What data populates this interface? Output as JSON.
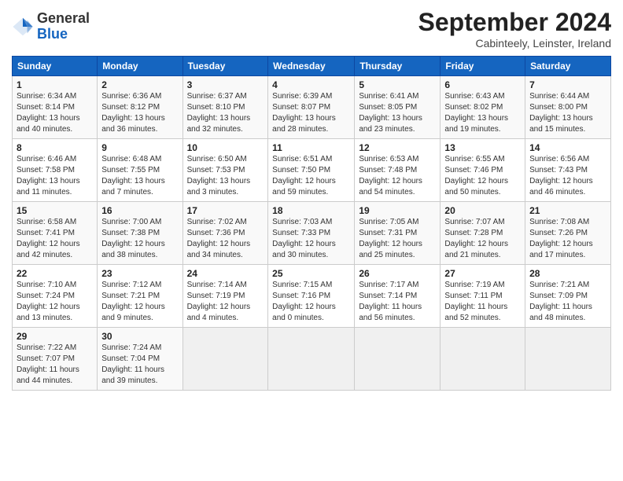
{
  "header": {
    "logo_general": "General",
    "logo_blue": "Blue",
    "title": "September 2024",
    "subtitle": "Cabinteely, Leinster, Ireland"
  },
  "columns": [
    "Sunday",
    "Monday",
    "Tuesday",
    "Wednesday",
    "Thursday",
    "Friday",
    "Saturday"
  ],
  "weeks": [
    [
      {
        "day": "1",
        "sunrise": "6:34 AM",
        "sunset": "8:14 PM",
        "daylight": "13 hours and 40 minutes."
      },
      {
        "day": "2",
        "sunrise": "6:36 AM",
        "sunset": "8:12 PM",
        "daylight": "13 hours and 36 minutes."
      },
      {
        "day": "3",
        "sunrise": "6:37 AM",
        "sunset": "8:10 PM",
        "daylight": "13 hours and 32 minutes."
      },
      {
        "day": "4",
        "sunrise": "6:39 AM",
        "sunset": "8:07 PM",
        "daylight": "13 hours and 28 minutes."
      },
      {
        "day": "5",
        "sunrise": "6:41 AM",
        "sunset": "8:05 PM",
        "daylight": "13 hours and 23 minutes."
      },
      {
        "day": "6",
        "sunrise": "6:43 AM",
        "sunset": "8:02 PM",
        "daylight": "13 hours and 19 minutes."
      },
      {
        "day": "7",
        "sunrise": "6:44 AM",
        "sunset": "8:00 PM",
        "daylight": "13 hours and 15 minutes."
      }
    ],
    [
      {
        "day": "8",
        "sunrise": "6:46 AM",
        "sunset": "7:58 PM",
        "daylight": "13 hours and 11 minutes."
      },
      {
        "day": "9",
        "sunrise": "6:48 AM",
        "sunset": "7:55 PM",
        "daylight": "13 hours and 7 minutes."
      },
      {
        "day": "10",
        "sunrise": "6:50 AM",
        "sunset": "7:53 PM",
        "daylight": "13 hours and 3 minutes."
      },
      {
        "day": "11",
        "sunrise": "6:51 AM",
        "sunset": "7:50 PM",
        "daylight": "12 hours and 59 minutes."
      },
      {
        "day": "12",
        "sunrise": "6:53 AM",
        "sunset": "7:48 PM",
        "daylight": "12 hours and 54 minutes."
      },
      {
        "day": "13",
        "sunrise": "6:55 AM",
        "sunset": "7:46 PM",
        "daylight": "12 hours and 50 minutes."
      },
      {
        "day": "14",
        "sunrise": "6:56 AM",
        "sunset": "7:43 PM",
        "daylight": "12 hours and 46 minutes."
      }
    ],
    [
      {
        "day": "15",
        "sunrise": "6:58 AM",
        "sunset": "7:41 PM",
        "daylight": "12 hours and 42 minutes."
      },
      {
        "day": "16",
        "sunrise": "7:00 AM",
        "sunset": "7:38 PM",
        "daylight": "12 hours and 38 minutes."
      },
      {
        "day": "17",
        "sunrise": "7:02 AM",
        "sunset": "7:36 PM",
        "daylight": "12 hours and 34 minutes."
      },
      {
        "day": "18",
        "sunrise": "7:03 AM",
        "sunset": "7:33 PM",
        "daylight": "12 hours and 30 minutes."
      },
      {
        "day": "19",
        "sunrise": "7:05 AM",
        "sunset": "7:31 PM",
        "daylight": "12 hours and 25 minutes."
      },
      {
        "day": "20",
        "sunrise": "7:07 AM",
        "sunset": "7:28 PM",
        "daylight": "12 hours and 21 minutes."
      },
      {
        "day": "21",
        "sunrise": "7:08 AM",
        "sunset": "7:26 PM",
        "daylight": "12 hours and 17 minutes."
      }
    ],
    [
      {
        "day": "22",
        "sunrise": "7:10 AM",
        "sunset": "7:24 PM",
        "daylight": "12 hours and 13 minutes."
      },
      {
        "day": "23",
        "sunrise": "7:12 AM",
        "sunset": "7:21 PM",
        "daylight": "12 hours and 9 minutes."
      },
      {
        "day": "24",
        "sunrise": "7:14 AM",
        "sunset": "7:19 PM",
        "daylight": "12 hours and 4 minutes."
      },
      {
        "day": "25",
        "sunrise": "7:15 AM",
        "sunset": "7:16 PM",
        "daylight": "12 hours and 0 minutes."
      },
      {
        "day": "26",
        "sunrise": "7:17 AM",
        "sunset": "7:14 PM",
        "daylight": "11 hours and 56 minutes."
      },
      {
        "day": "27",
        "sunrise": "7:19 AM",
        "sunset": "7:11 PM",
        "daylight": "11 hours and 52 minutes."
      },
      {
        "day": "28",
        "sunrise": "7:21 AM",
        "sunset": "7:09 PM",
        "daylight": "11 hours and 48 minutes."
      }
    ],
    [
      {
        "day": "29",
        "sunrise": "7:22 AM",
        "sunset": "7:07 PM",
        "daylight": "11 hours and 44 minutes."
      },
      {
        "day": "30",
        "sunrise": "7:24 AM",
        "sunset": "7:04 PM",
        "daylight": "11 hours and 39 minutes."
      },
      null,
      null,
      null,
      null,
      null
    ]
  ]
}
